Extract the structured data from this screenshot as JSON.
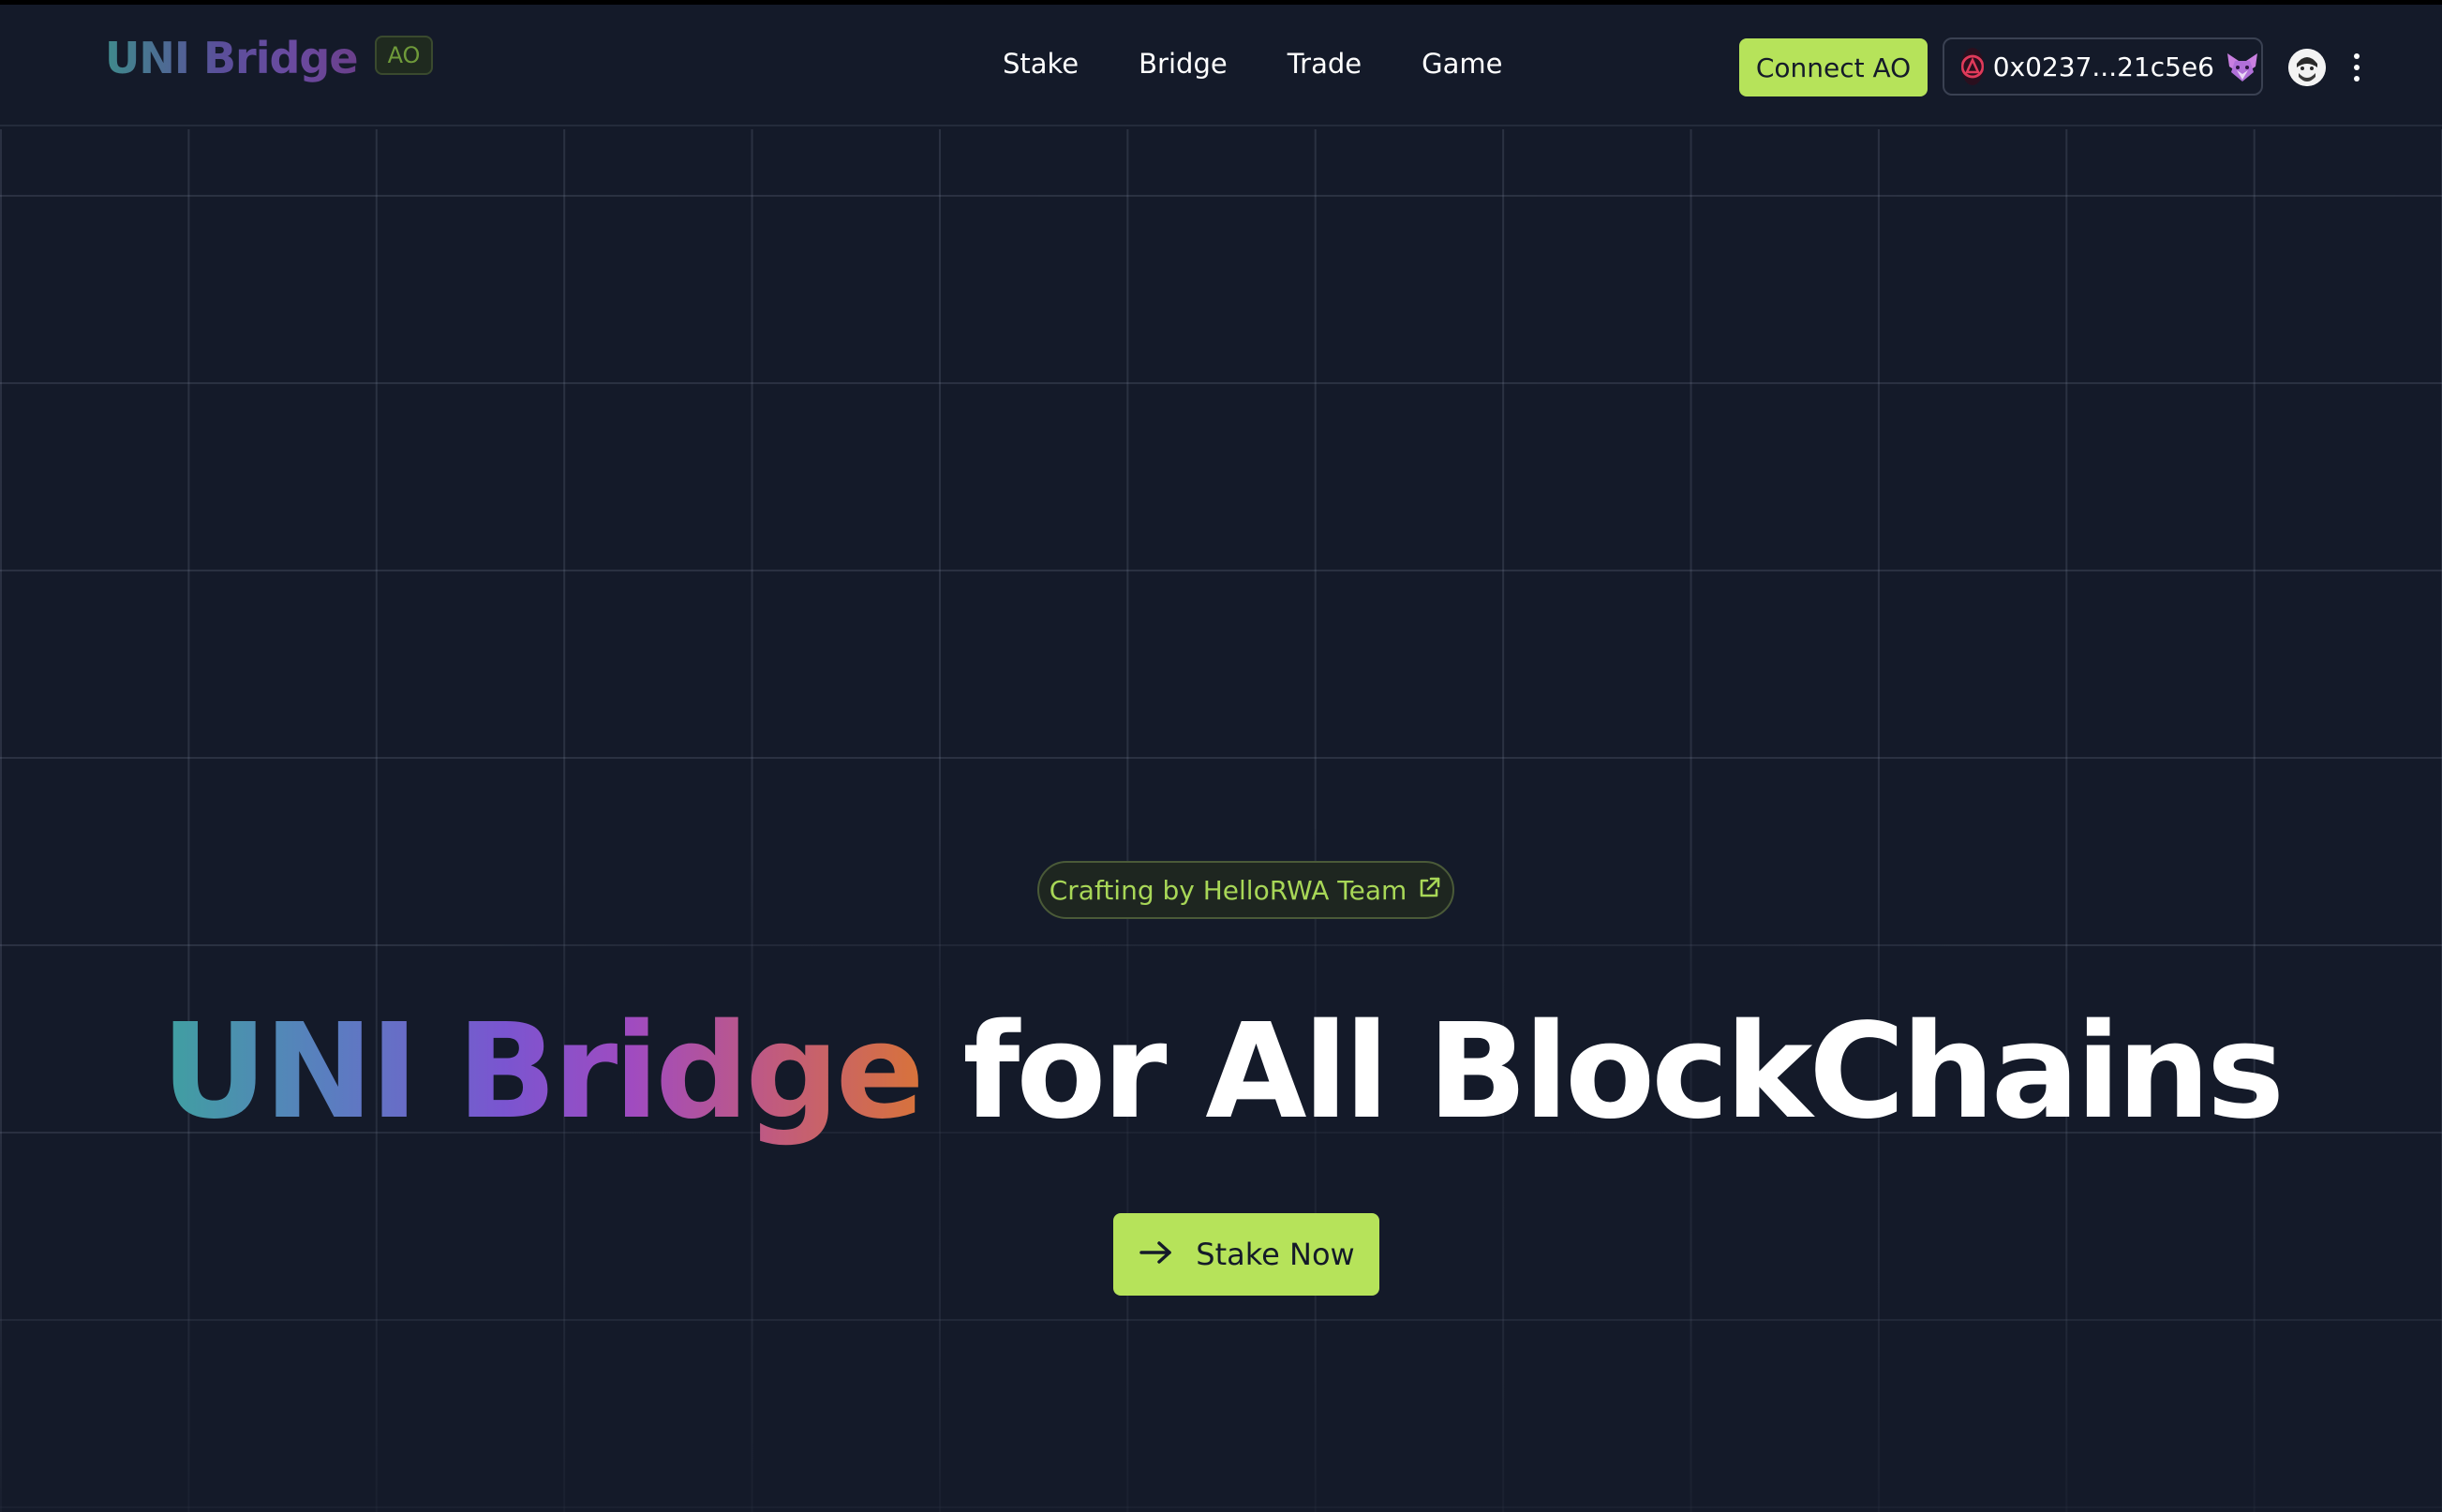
{
  "header": {
    "logo_text": "UNI Bridge",
    "logo_badge": "AO",
    "nav": [
      {
        "label": "Stake"
      },
      {
        "label": "Bridge"
      },
      {
        "label": "Trade"
      },
      {
        "label": "Game"
      }
    ],
    "connect_label": "Connect AO",
    "wallet_address": "0x0237...21c5e6",
    "icons": {
      "arweave": "arweave-logo-icon",
      "wallet": "metamask-fox-icon",
      "avatar": "user-avatar",
      "more": "kebab-menu-icon"
    }
  },
  "hero": {
    "pill_label": "Crafting by HelloRWA Team",
    "pill_icon": "external-link-icon",
    "title_gradient": "UNI Bridge",
    "title_rest": "for All BlockChains",
    "cta_label": "Stake Now",
    "cta_icon": "arrow-right-icon"
  },
  "colors": {
    "background": "#141a29",
    "accent": "#b6e35a",
    "pill_text": "#a8d757"
  }
}
